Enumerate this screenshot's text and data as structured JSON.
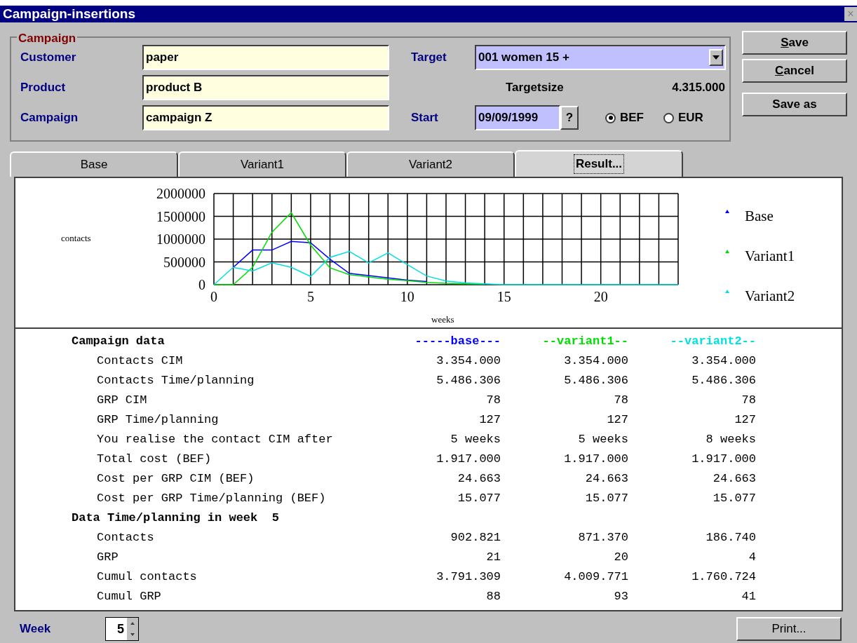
{
  "window": {
    "title": "Campaign-insertions",
    "close": "×"
  },
  "campaign": {
    "legend": "Campaign",
    "fields": [
      {
        "label": "Customer",
        "value": "paper"
      },
      {
        "label": "Product",
        "value": "product B"
      },
      {
        "label": "Campaign",
        "value": "campaign Z"
      }
    ],
    "target": {
      "label": "Target",
      "value": "001 women 15 +"
    },
    "targetsize": {
      "label": "Targetsize",
      "value": "4.315.000"
    },
    "start": {
      "label": "Start",
      "value": "09/09/1999",
      "help": "?"
    },
    "currency": [
      {
        "label": "BEF",
        "selected": true
      },
      {
        "label": "EUR",
        "selected": false
      }
    ]
  },
  "buttons": [
    {
      "label": "Save",
      "mnemonic": true
    },
    {
      "label": "Cancel",
      "mnemonic": true
    },
    {
      "label": "Save as",
      "mnemonic": false
    }
  ],
  "tabs": [
    {
      "label": "Base",
      "selected": false
    },
    {
      "label": "Variant1",
      "selected": false
    },
    {
      "label": "Variant2",
      "selected": false
    },
    {
      "label": "Result...",
      "selected": true
    }
  ],
  "chart_data": {
    "type": "line",
    "xlabel": "weeks",
    "annotations": [
      {
        "text": "contacts"
      }
    ],
    "grid": true,
    "legend": true,
    "xlim": [
      0,
      24
    ],
    "ylim": [
      0,
      2000000
    ],
    "xticks": [
      0,
      5,
      10,
      15,
      20
    ],
    "yticks": [
      0,
      500000,
      1000000,
      1500000,
      2000000
    ],
    "x": [
      0,
      1,
      2,
      3,
      4,
      5,
      6,
      7,
      8,
      9,
      10,
      11,
      12,
      13,
      14,
      15,
      16,
      17,
      18,
      19,
      20,
      21,
      22,
      23,
      24
    ],
    "series": [
      {
        "name": "Base",
        "color": "#0000ff",
        "values": [
          null,
          380000,
          760000,
          760000,
          950000,
          920000,
          560000,
          250000,
          200000,
          150000,
          100000,
          70000,
          null,
          null,
          null,
          null,
          null,
          null,
          null,
          null,
          null,
          null,
          null,
          null,
          null
        ]
      },
      {
        "name": "Variant1",
        "color": "#00dd00",
        "values": [
          0,
          0,
          380000,
          1150000,
          1580000,
          870000,
          370000,
          220000,
          170000,
          120000,
          90000,
          50000,
          30000,
          20000,
          10000,
          null,
          null,
          null,
          null,
          null,
          null,
          null,
          null,
          null,
          null
        ]
      },
      {
        "name": "Variant2",
        "color": "#00e0e0",
        "values": [
          0,
          380000,
          300000,
          480000,
          380000,
          180000,
          600000,
          730000,
          480000,
          700000,
          440000,
          190000,
          80000,
          40000,
          20000,
          0,
          0,
          0,
          0,
          0,
          0,
          0,
          0,
          0,
          0
        ]
      }
    ]
  },
  "table": {
    "columns": [
      {
        "label": "-----base---",
        "color": "#0000ff"
      },
      {
        "label": "--variant1--",
        "color": "#00dd00"
      },
      {
        "label": "--variant2--",
        "color": "#00e0e0"
      }
    ],
    "sections": [
      {
        "title": "Campaign data",
        "rows": [
          {
            "label": "Contacts CIM",
            "values": [
              "3.354.000",
              "3.354.000",
              "3.354.000"
            ]
          },
          {
            "label": "Contacts Time/planning",
            "values": [
              "5.486.306",
              "5.486.306",
              "5.486.306"
            ]
          },
          {
            "label": "GRP CIM",
            "values": [
              "78",
              "78",
              "78"
            ]
          },
          {
            "label": "GRP Time/planning",
            "values": [
              "127",
              "127",
              "127"
            ]
          },
          {
            "label": "You realise the contact CIM after",
            "values": [
              "5 weeks",
              "5 weeks",
              "8 weeks"
            ]
          },
          {
            "label": "Total cost (BEF)",
            "values": [
              "1.917.000",
              "1.917.000",
              "1.917.000"
            ]
          },
          {
            "label": "Cost per GRP CIM (BEF)",
            "values": [
              "24.663",
              "24.663",
              "24.663"
            ]
          },
          {
            "label": "Cost per GRP Time/planning (BEF)",
            "values": [
              "15.077",
              "15.077",
              "15.077"
            ]
          }
        ]
      },
      {
        "title": "Data Time/planning in week  5",
        "rows": [
          {
            "label": "Contacts",
            "values": [
              "902.821",
              "871.370",
              "186.740"
            ]
          },
          {
            "label": "GRP",
            "values": [
              "21",
              "20",
              "4"
            ]
          },
          {
            "label": "Cumul contacts",
            "values": [
              "3.791.309",
              "4.009.771",
              "1.760.724"
            ]
          },
          {
            "label": "Cumul GRP",
            "values": [
              "88",
              "93",
              "41"
            ]
          }
        ]
      }
    ]
  },
  "footer": {
    "week_label": "Week",
    "week_value": "5",
    "print": "Print..."
  }
}
